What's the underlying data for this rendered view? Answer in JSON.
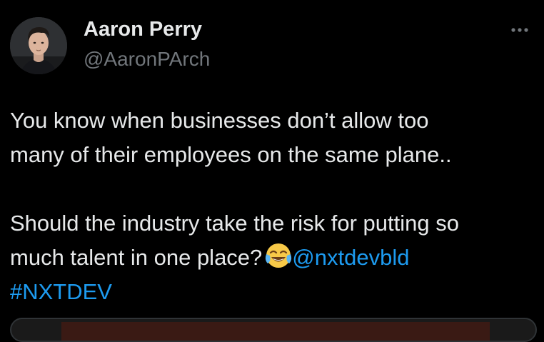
{
  "author": {
    "name": "Aaron Perry",
    "handle": "@AaronPArch"
  },
  "icons": {
    "more": "more-horizontal-icon",
    "emoji": "face-with-tears-of-joy-emoji"
  },
  "tweet": {
    "line1": "You know when businesses don’t allow too",
    "line2": "many of their employees on the same plane..",
    "line3": "Should the industry take the risk for putting so",
    "line4_text": "much talent in one place?",
    "mention": "@nxtdevbld",
    "hashtag": "#NXTDEV"
  },
  "colors": {
    "background": "#000000",
    "text": "#e7e9ea",
    "secondary": "#71767b",
    "link": "#1d9bf0"
  }
}
